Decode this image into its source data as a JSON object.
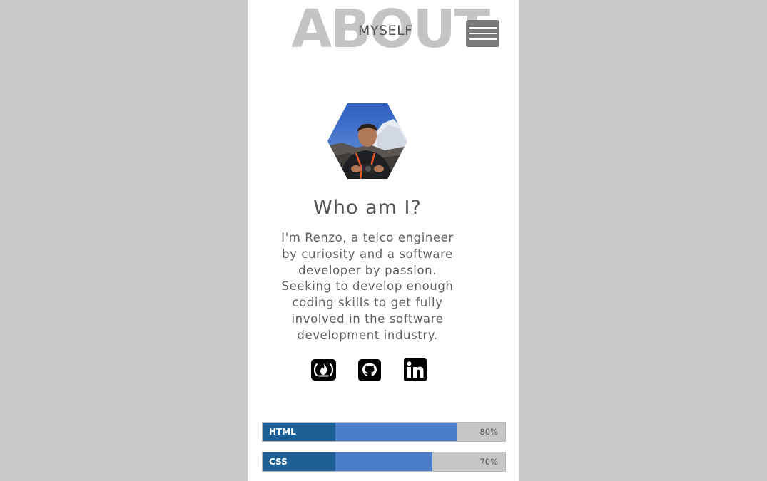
{
  "header": {
    "title_big": "ABOUT",
    "title_small": "MYSELF",
    "menu_icon": "hamburger-icon"
  },
  "profile": {
    "avatar_alt": "profile photo"
  },
  "content": {
    "heading": "Who am I?",
    "bio": "I'm Renzo, a telco engineer by curiosity and a software developer by passion. Seeking to develop enough coding skills to get fully involved in the software development industry."
  },
  "social": [
    {
      "icon": "freecodecamp-icon"
    },
    {
      "icon": "github-icon"
    },
    {
      "icon": "linkedin-icon"
    }
  ],
  "skills": [
    {
      "label": "HTML",
      "percent_text": "80%",
      "level": 0.8
    },
    {
      "label": "CSS",
      "percent_text": "70%",
      "level": 0.7
    }
  ],
  "colors": {
    "page_bg": "#c8c8c8",
    "label_bg": "#1d5e95",
    "bar_fill": "#4b7dc9",
    "track": "#c6c6c6"
  }
}
